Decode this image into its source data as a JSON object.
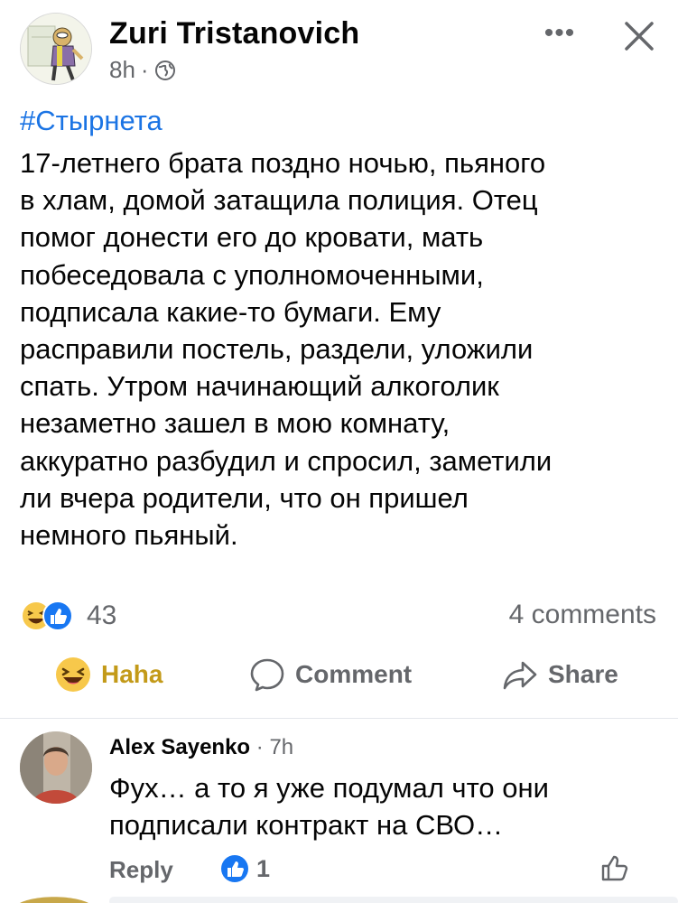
{
  "post": {
    "author": "Zuri Tristanovich",
    "time": "8h",
    "separator": "·",
    "audience_icon": "globe-icon",
    "more_icon": "more-options-icon",
    "more_glyph": "•••",
    "close_icon": "close-icon",
    "hashtag": "#Стырнета",
    "text": "17-летнего брата поздно ночью, пьяного\nв хлам, домой затащила полиция. Отец\nпомог донести его до кровати, мать\nпобеседовала с уполномоченными,\nподписала какие-то бумаги. Ему\nрасправили постель, раздели, уложили\nспать. Утром начинающий алкоголик\nнезаметно зашел в мою комнату,\nаккуратно разбудил и спросил, заметили\nли вчера родители, что он пришел\nнемного пьяный.",
    "reaction_count": "43",
    "comments_count": "4 comments"
  },
  "actions": {
    "haha": "Haha",
    "comment": "Comment",
    "share": "Share"
  },
  "comment": {
    "author": "Alex Sayenko",
    "separator": "·",
    "time": "7h",
    "text": "Фух… а то я уже подумал что они\nподписали контракт на СВО…",
    "reply": "Reply",
    "like_count": "1"
  },
  "colors": {
    "link": "#1b74e4",
    "muted": "#65676b",
    "haha": "#c39a19",
    "like": "#1877f2"
  }
}
